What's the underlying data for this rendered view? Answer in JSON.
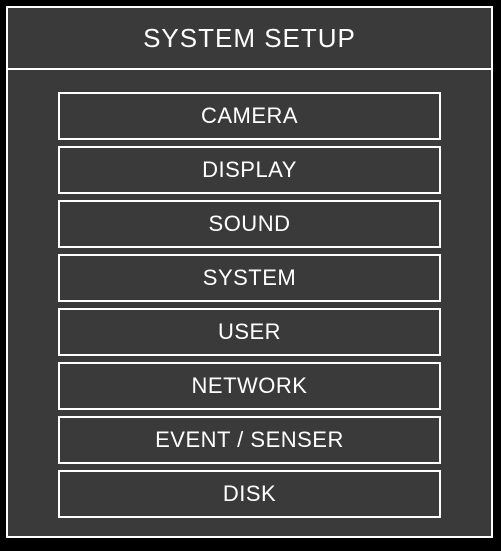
{
  "title": "SYSTEM SETUP",
  "menu": {
    "items": [
      {
        "label": "CAMERA"
      },
      {
        "label": "DISPLAY"
      },
      {
        "label": "SOUND"
      },
      {
        "label": "SYSTEM"
      },
      {
        "label": "USER"
      },
      {
        "label": "NETWORK"
      },
      {
        "label": "EVENT / SENSER"
      },
      {
        "label": "DISK"
      }
    ]
  }
}
